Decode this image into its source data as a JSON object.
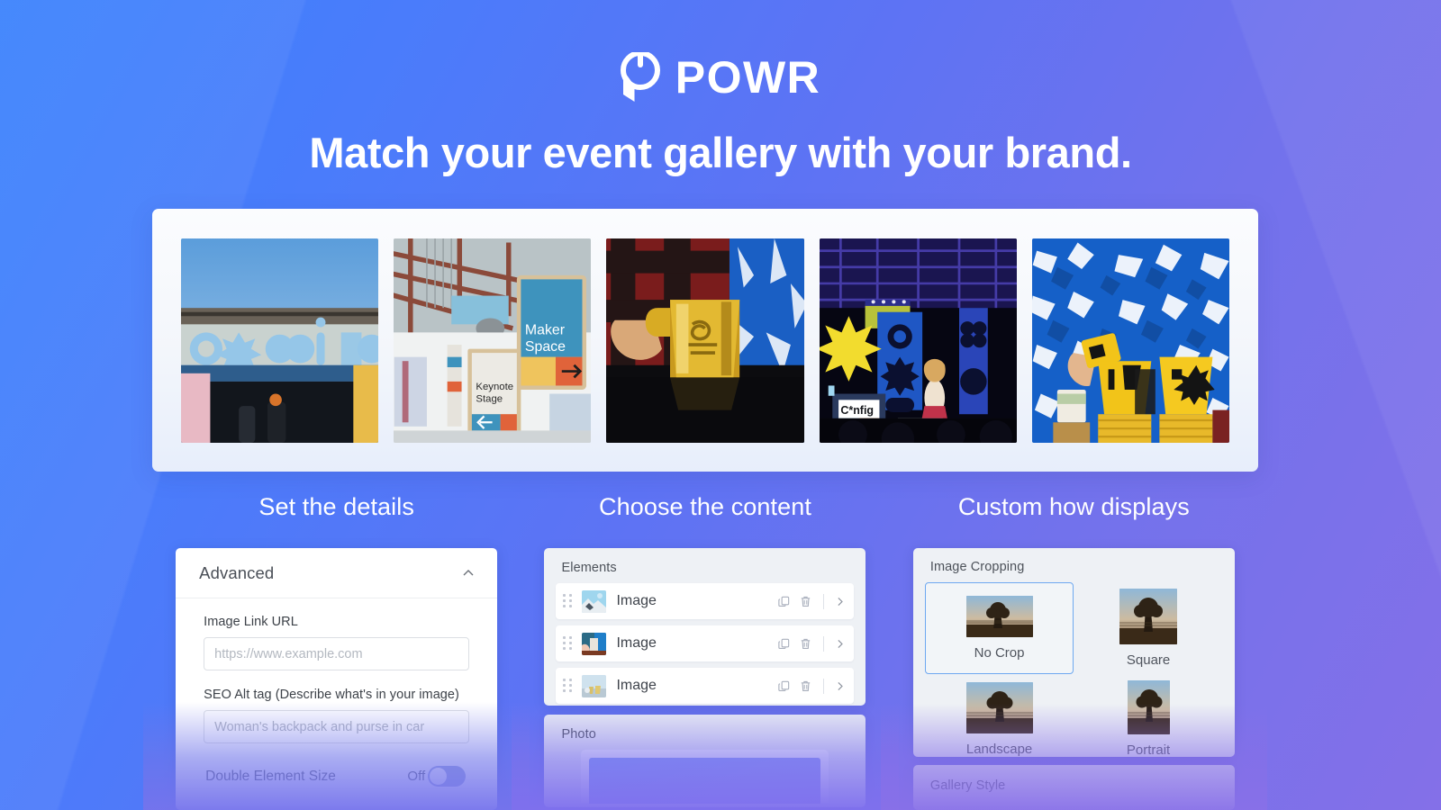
{
  "brand": {
    "logo_icon": "powr-logo-icon",
    "name": "POWR",
    "headline": "Match your event gallery with your brand.",
    "accent_color": "#3b82fc",
    "gradient_start": "#3b82fc",
    "gradient_end": "#8470e8"
  },
  "hero_gallery": {
    "images": [
      {
        "alt": "Event venue facade with Config signage",
        "id": "gallery-image-1"
      },
      {
        "alt": "Venue interior with Maker Space and Keynote Stage signs",
        "id": "gallery-image-2"
      },
      {
        "alt": "Hand holding a gold pitcher on a reflective table",
        "id": "gallery-image-3"
      },
      {
        "alt": "Conference keynote stage with speaker and yellow star",
        "id": "gallery-image-4"
      },
      {
        "alt": "Stacked yellow cups against blue tie-dye backdrop",
        "id": "gallery-image-5"
      }
    ]
  },
  "sections": [
    {
      "title": "Set the details"
    },
    {
      "title": "Choose the content"
    },
    {
      "title": "Custom how displays"
    }
  ],
  "advanced_panel": {
    "title": "Advanced",
    "collapse_icon": "chevron-up-icon",
    "fields": [
      {
        "label": "Image Link URL",
        "value": "",
        "placeholder": "https://www.example.com"
      },
      {
        "label": "SEO Alt tag (Describe what's in your image)",
        "value": "",
        "placeholder": "Woman's backpack and purse in car"
      }
    ],
    "toggle": {
      "label": "Double Element Size",
      "state_label": "Off",
      "state": false
    }
  },
  "elements_panel": {
    "heading": "Elements",
    "rows": [
      {
        "label": "Image",
        "thumb": "thumb-mountain",
        "duplicate_icon": "copy-icon",
        "delete_icon": "trash-icon",
        "expand_icon": "chevron-right-icon"
      },
      {
        "label": "Image",
        "thumb": "thumb-pitcher",
        "duplicate_icon": "copy-icon",
        "delete_icon": "trash-icon",
        "expand_icon": "chevron-right-icon"
      },
      {
        "label": "Image",
        "thumb": "thumb-cups",
        "duplicate_icon": "copy-icon",
        "delete_icon": "trash-icon",
        "expand_icon": "chevron-right-icon"
      }
    ]
  },
  "photo_panel": {
    "heading": "Photo"
  },
  "cropping_panel": {
    "heading": "Image Cropping",
    "options": [
      {
        "label": "No Crop",
        "shape": "nocrop",
        "selected": true
      },
      {
        "label": "Square",
        "shape": "square",
        "selected": false
      },
      {
        "label": "Landscape",
        "shape": "landscape",
        "selected": false
      },
      {
        "label": "Portrait",
        "shape": "portrait",
        "selected": false
      }
    ],
    "selected_border_color": "#6ea8f0"
  },
  "gallery_style_panel": {
    "heading": "Gallery Style"
  }
}
